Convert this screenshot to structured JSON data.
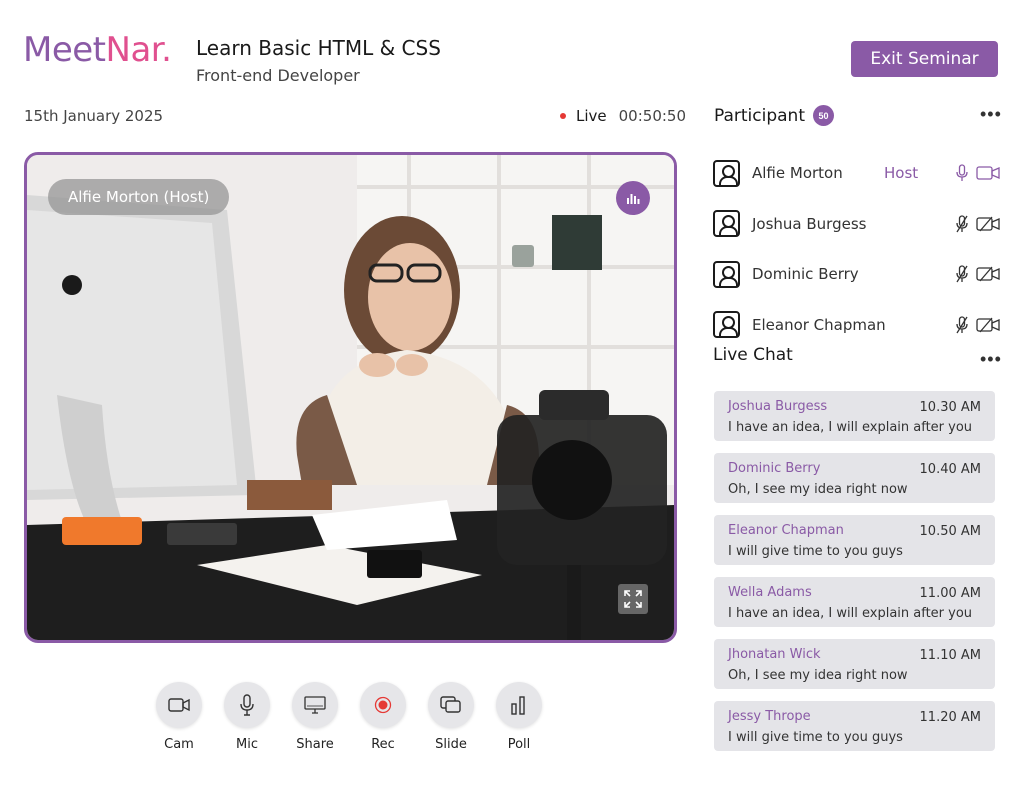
{
  "header": {
    "logo_part1": "Meet",
    "logo_part2": "Nar.",
    "title": "Learn Basic HTML & CSS",
    "subtitle": "Front-end Developer",
    "exit_label": "Exit Seminar"
  },
  "status": {
    "date": "15th January 2025",
    "live_label": "Live",
    "elapsed": "00:50:50"
  },
  "video": {
    "host_label": "Alfie Morton (Host)"
  },
  "controls": [
    {
      "label": "Cam",
      "icon": "camera-icon"
    },
    {
      "label": "Mic",
      "icon": "mic-icon"
    },
    {
      "label": "Share",
      "icon": "screen-share-icon"
    },
    {
      "label": "Rec",
      "icon": "record-icon"
    },
    {
      "label": "Slide",
      "icon": "slides-icon"
    },
    {
      "label": "Poll",
      "icon": "poll-icon"
    }
  ],
  "participants": {
    "heading": "Participant",
    "count": "50",
    "list": [
      {
        "name": "Alfie Morton",
        "tag": "Host",
        "mic": "on",
        "cam": "on"
      },
      {
        "name": "Joshua Burgess",
        "tag": "",
        "mic": "off",
        "cam": "off"
      },
      {
        "name": "Dominic Berry",
        "tag": "",
        "mic": "off",
        "cam": "off"
      },
      {
        "name": "Eleanor Chapman",
        "tag": "",
        "mic": "off",
        "cam": "off"
      }
    ]
  },
  "chat": {
    "heading": "Live Chat",
    "messages": [
      {
        "name": "Joshua Burgess",
        "time": "10.30 AM",
        "text": "I have an idea, I will explain after you"
      },
      {
        "name": "Dominic Berry",
        "time": "10.40 AM",
        "text": "Oh, I see my idea right now"
      },
      {
        "name": "Eleanor Chapman",
        "time": "10.50 AM",
        "text": "I will give time to you guys"
      },
      {
        "name": "Wella Adams",
        "time": "11.00 AM",
        "text": "I have an idea, I will explain after you"
      },
      {
        "name": "Jhonatan Wick",
        "time": "11.10 AM",
        "text": "Oh, I see my idea right now"
      },
      {
        "name": "Jessy Thrope",
        "time": "11.20 AM",
        "text": "I will give time to you guys"
      }
    ]
  },
  "colors": {
    "accent": "#8a5aa6",
    "brand_pink": "#e0508f",
    "live_dot": "#e53935",
    "chat_bg": "#e4e4e8"
  }
}
